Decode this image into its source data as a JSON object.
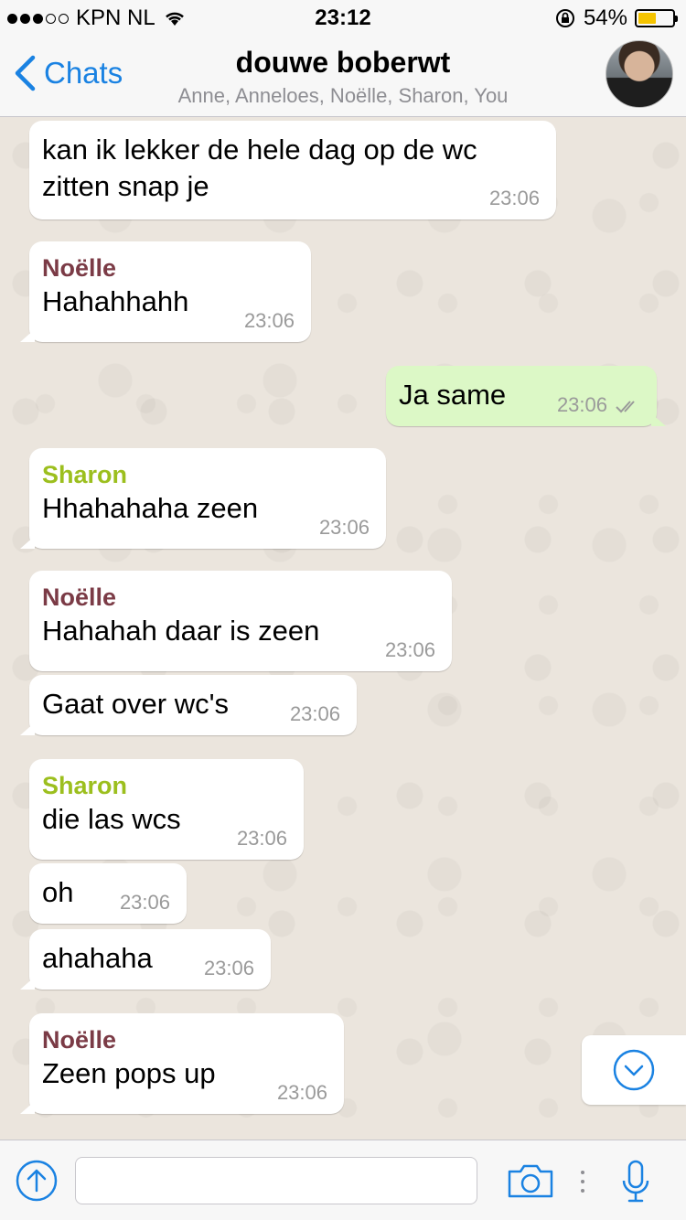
{
  "status_bar": {
    "carrier": "KPN NL",
    "time": "23:12",
    "battery": "54%",
    "battery_level": 0.54,
    "signal_bars": 3
  },
  "nav": {
    "back_label": "Chats",
    "title": "douwe boberwt",
    "subtitle": "Anne, Anneloes, Noëlle, Sharon, You"
  },
  "colors": {
    "accent": "#1a82e2",
    "noelle": "#7b3b46",
    "sharon": "#9cbf1e",
    "outgoing": "#dcf8c6"
  },
  "messages": [
    {
      "sender": "",
      "text": "kan ik lekker de hele dag op de wc zitten snap je",
      "time": "23:06"
    },
    {
      "sender": "Noëlle",
      "text": "Hahahhahh",
      "time": "23:06"
    },
    {
      "sender": "",
      "text": "Ja same",
      "time": "23:06"
    },
    {
      "sender": "Sharon",
      "text": "Hhahahaha zeen",
      "time": "23:06"
    },
    {
      "sender": "Noëlle",
      "text": "Hahahah daar is zeen",
      "time": "23:06"
    },
    {
      "sender": "",
      "text": "Gaat over wc's",
      "time": "23:06"
    },
    {
      "sender": "Sharon",
      "text": "die las wcs",
      "time": "23:06"
    },
    {
      "sender": "",
      "text": "oh",
      "time": "23:06"
    },
    {
      "sender": "",
      "text": "ahahaha",
      "time": "23:06"
    },
    {
      "sender": "Noëlle",
      "text": "Zeen pops up",
      "time": "23:06"
    }
  ],
  "input": {
    "value": "",
    "placeholder": ""
  },
  "icons": {
    "back": "chevron-left-icon",
    "share": "arrow-up-circle-icon",
    "camera": "camera-icon",
    "more": "vertical-dots-icon",
    "mic": "microphone-icon",
    "scroll": "chevron-down-circle-icon",
    "wifi": "wifi-icon",
    "lock": "rotation-lock-icon",
    "read": "double-check-icon"
  }
}
